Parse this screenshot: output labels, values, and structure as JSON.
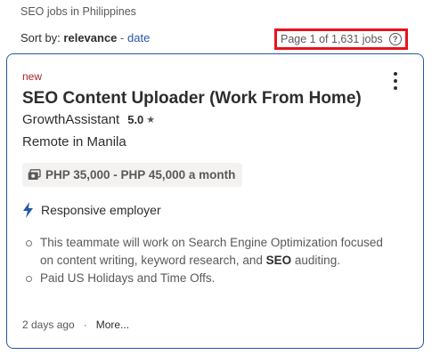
{
  "breadcrumb": "SEO jobs in Philippines",
  "sort": {
    "label": "Sort by:",
    "current": "relevance",
    "separator": "-",
    "alternative": "date"
  },
  "page_count": "Page 1 of 1,631 jobs",
  "help_icon_glyph": "?",
  "job": {
    "badge": "new",
    "title": "SEO Content Uploader (Work From Home)",
    "company": "GrowthAssistant",
    "rating": "5.0",
    "rating_icon": "star-icon",
    "location": "Remote in Manila",
    "salary": "PHP 35,000 - PHP 45,000 a month",
    "salary_icon": "salary-icon",
    "responsive_label": "Responsive employer",
    "responsive_icon": "lightning-icon",
    "snippet": {
      "line1_pre": "This teammate will work on Search Engine Optimization focused on content writing, keyword research, and ",
      "line1_bold": "SEO",
      "line1_post": " auditing.",
      "line2": "Paid US Holidays and Time Offs."
    },
    "posted": "2 days ago",
    "dot": "·",
    "more": "More..."
  },
  "colors": {
    "link": "#2557a7",
    "new_badge": "#a9252b",
    "highlight_box": "#e8121c",
    "text": "#2d2d2d",
    "muted": "#595959"
  }
}
